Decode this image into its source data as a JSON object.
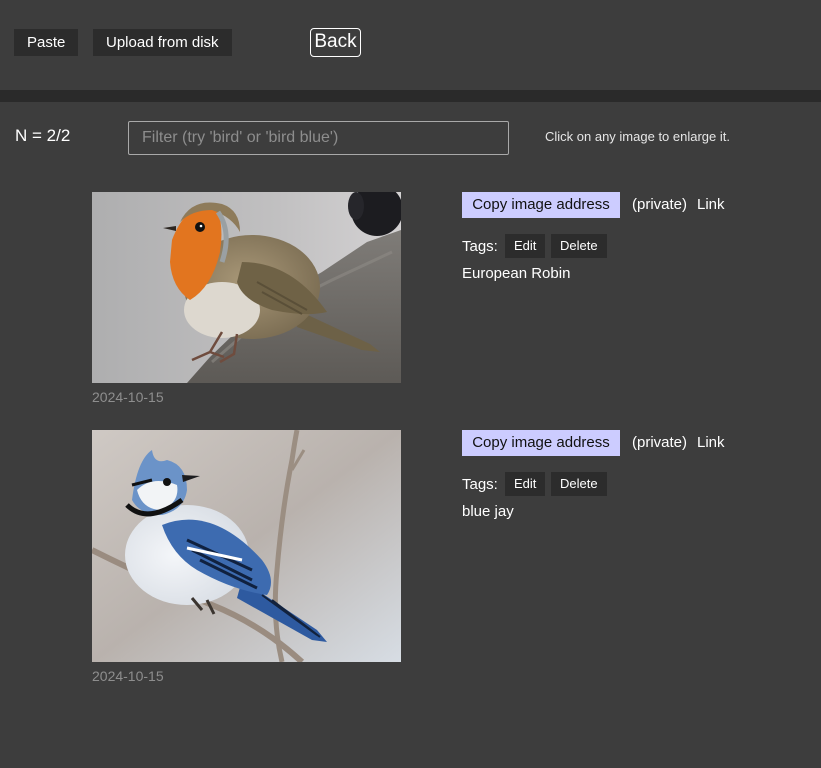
{
  "toolbar": {
    "paste_label": "Paste",
    "upload_label": "Upload from disk",
    "back_label": "Back"
  },
  "status": {
    "count": "N = 2/2",
    "hint": "Click on any image to enlarge it."
  },
  "filter": {
    "placeholder": "Filter (try 'bird' or 'bird blue')",
    "value": ""
  },
  "items": [
    {
      "date": "2024-10-15",
      "copy_label": "Copy image address",
      "visibility": "(private)",
      "link_label": "Link",
      "tags_label": "Tags:",
      "edit_label": "Edit",
      "delete_label": "Delete",
      "tags": "European Robin"
    },
    {
      "date": "2024-10-15",
      "copy_label": "Copy image address",
      "visibility": "(private)",
      "link_label": "Link",
      "tags_label": "Tags:",
      "edit_label": "Edit",
      "delete_label": "Delete",
      "tags": "blue jay"
    }
  ]
}
